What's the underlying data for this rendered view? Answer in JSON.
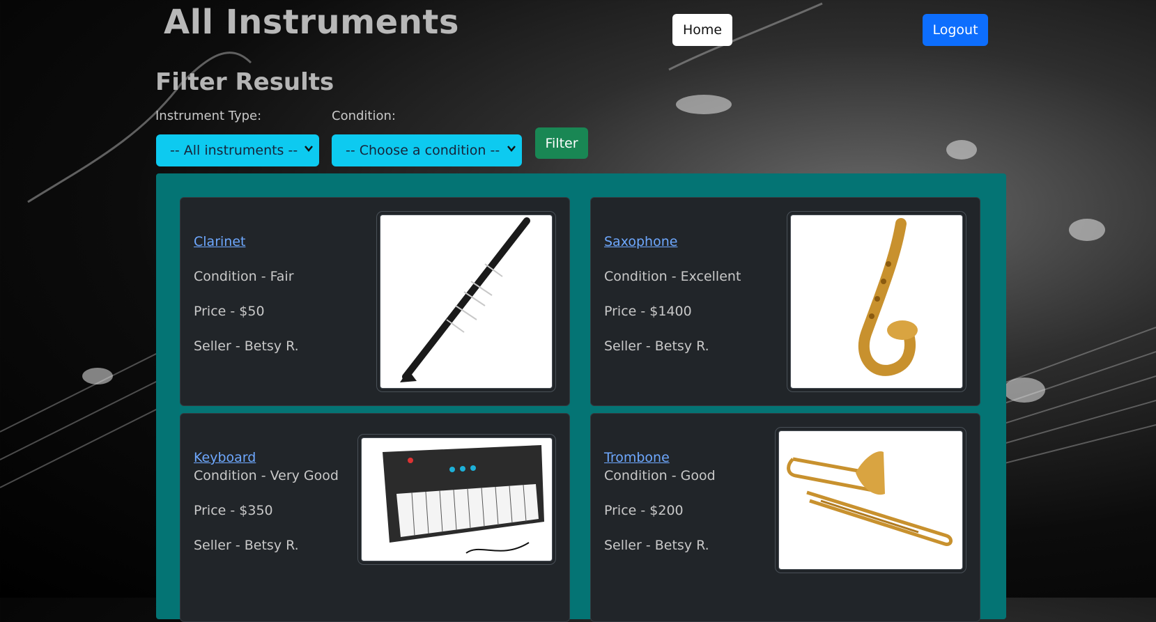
{
  "header": {
    "title": "All Instruments",
    "home_label": "Home",
    "logout_label": "Logout"
  },
  "filter": {
    "title": "Filter Results",
    "type_label": "Instrument Type:",
    "type_selected": "-- All instruments --",
    "condition_label": "Condition:",
    "condition_selected": "-- Choose a condition --",
    "button_label": "Filter"
  },
  "colors": {
    "results_bg": "#047474",
    "card_bg": "#212529",
    "link": "#6ea8fe",
    "logout": "#0d6efd",
    "filter_button": "#198754",
    "select_bg": "#0dcaf0"
  },
  "instruments": [
    {
      "name": "Clarinet",
      "condition": "Condition - Fair",
      "price": "Price - $50",
      "seller": "Seller - Betsy R.",
      "image_icon": "clarinet-image"
    },
    {
      "name": "Saxophone",
      "condition": "Condition - Excellent",
      "price": "Price - $1400",
      "seller": "Seller - Betsy R.",
      "image_icon": "saxophone-image"
    },
    {
      "name": "Keyboard",
      "condition": "Condition - Very Good",
      "price": "Price - $350",
      "seller": "Seller - Betsy R.",
      "image_icon": "keyboard-image"
    },
    {
      "name": "Trombone",
      "condition": "Condition - Good",
      "price": "Price - $200",
      "seller": "Seller - Betsy R.",
      "image_icon": "trombone-image"
    }
  ]
}
